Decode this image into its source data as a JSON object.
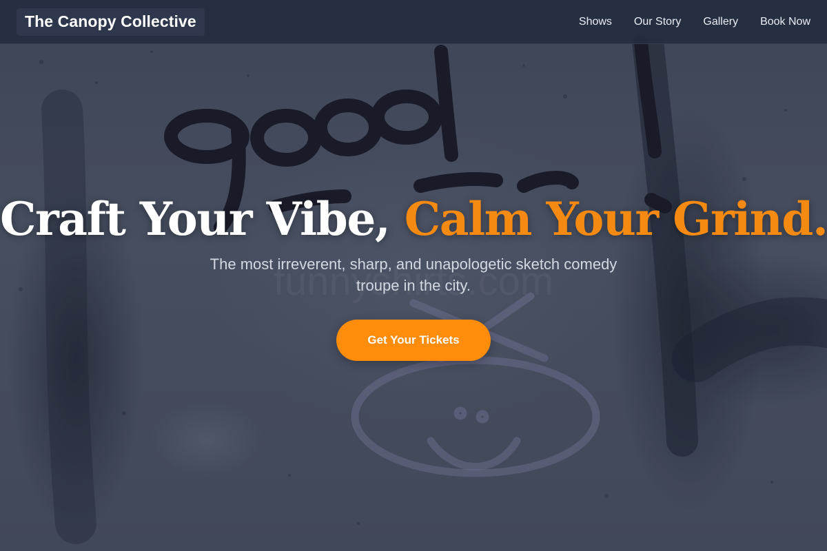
{
  "brand": {
    "name": "The Canopy Collective"
  },
  "nav": {
    "items": [
      {
        "label": "Shows"
      },
      {
        "label": "Our Story"
      },
      {
        "label": "Gallery"
      },
      {
        "label": "Book Now"
      }
    ]
  },
  "hero": {
    "headline_white": "Craft Your Vibe,",
    "headline_accent": "Calm Your Grind.",
    "subtitle": "The most irreverent, sharp, and unapologetic sketch comedy troupe in the city.",
    "cta_label": "Get Your Tickets",
    "background_graffiti_text": "good",
    "background_watermark_text": "funnyshirts.com"
  },
  "colors": {
    "accent": "#f58a12",
    "button": "#ff8c0a",
    "navbar": "#242e40",
    "text_light": "#ffffff",
    "subtitle": "#d4d8e1"
  }
}
